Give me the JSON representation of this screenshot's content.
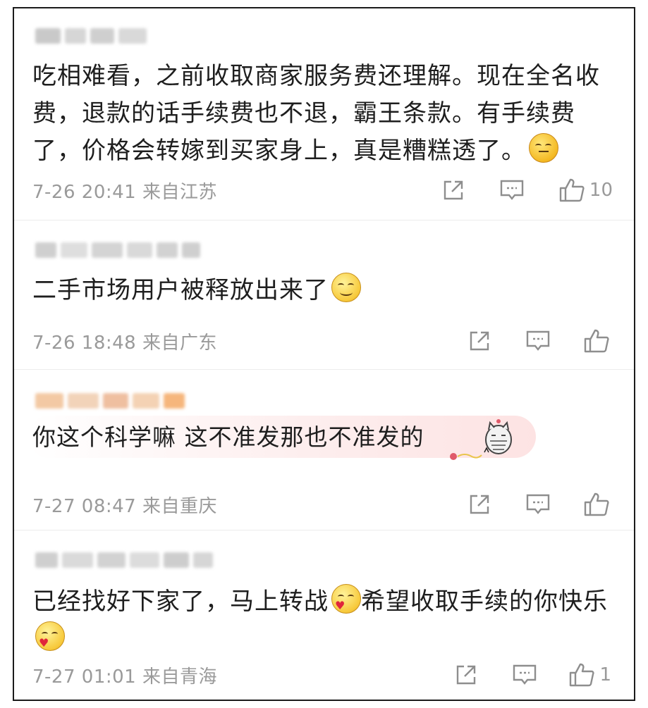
{
  "comments": [
    {
      "text": "吃相难看，之前收取商家服务费还理解。现在全名收费，退款的话手续费也不退，霸王条款。有手续费了，价格会转嫁到买家身上，真是糟糕透了。",
      "emoji": "yellow-face-emoji",
      "time": "7-26 20:41 来自江苏",
      "likes": "10"
    },
    {
      "text": "二手市场用户被释放出来了",
      "emoji": "smile-face-emoji",
      "time": "7-26 18:48 来自广东",
      "likes": ""
    },
    {
      "text": "你这个科学嘛 这不准发那也不准发的",
      "emoji": "",
      "time": "7-27 08:47 来自重庆",
      "likes": ""
    },
    {
      "text_a": "已经找好下家了，马上转战",
      "text_b": "希望收取手续的你快乐",
      "emoji": "heart-face-emoji",
      "time": "7-27 01:01 来自青海",
      "likes": "1"
    }
  ],
  "colors": {
    "meta_gray": "#9a9a9a",
    "text_dark": "#1e1e1e",
    "bubble_pink": "#fde3e3",
    "frame_border": "#1b1b1b"
  },
  "icons": [
    "share-icon",
    "comment-icon",
    "like-icon"
  ]
}
